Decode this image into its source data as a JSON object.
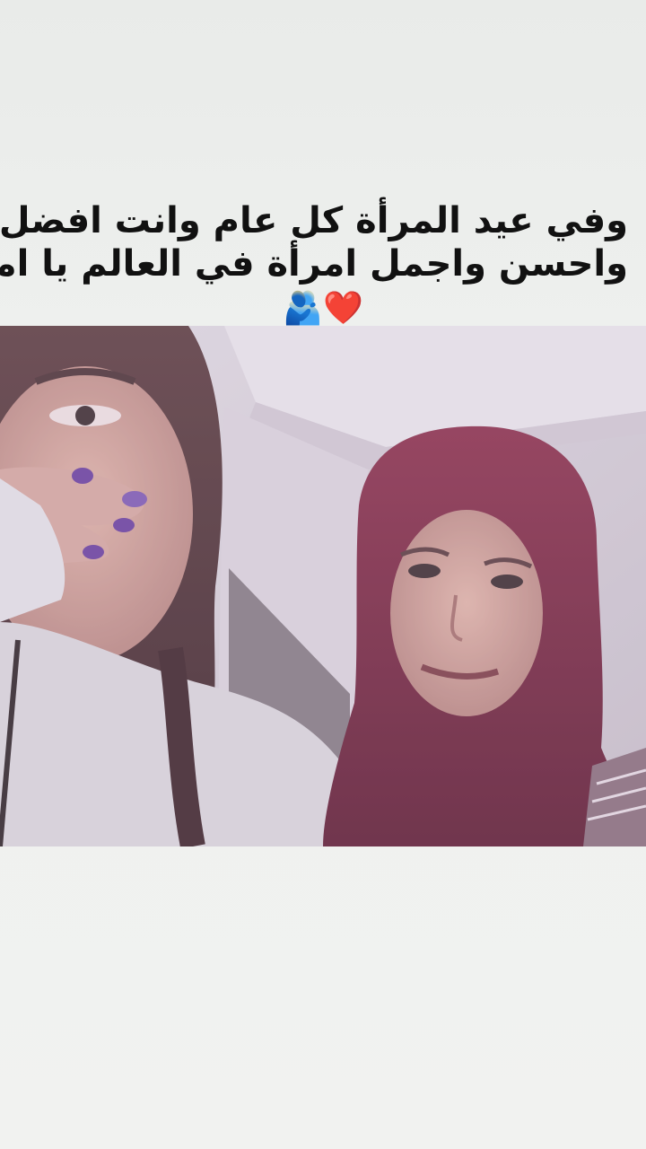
{
  "caption": {
    "line1": "وفي عيد المرأة كل عام وانت افضل",
    "line2": "واحسن واجمل امرأة في العالم يا امي",
    "line2_emoji": "🧕🏻",
    "line3_emoji": "❤️🫂"
  },
  "photo": {
    "description_icon": "selfie-photo"
  },
  "colors": {
    "background": "#eef0ee",
    "caption_text": "#111111",
    "hijab": "#7a2340",
    "wall": "#d9d3dc"
  }
}
